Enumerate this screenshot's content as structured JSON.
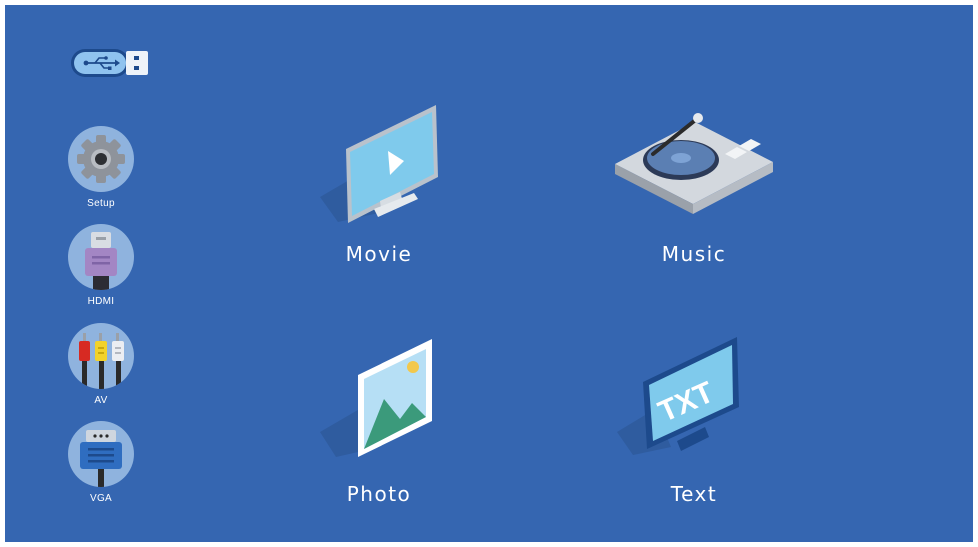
{
  "sources": [
    {
      "id": "setup",
      "label": "Setup",
      "icon": "gear-icon"
    },
    {
      "id": "hdmi",
      "label": "HDMI",
      "icon": "hdmi-plug-icon"
    },
    {
      "id": "av",
      "label": "AV",
      "icon": "rca-cables-icon"
    },
    {
      "id": "vga",
      "label": "VGA",
      "icon": "vga-plug-icon"
    }
  ],
  "media": {
    "movie": {
      "label": "Movie",
      "icon": "monitor-play-icon"
    },
    "music": {
      "label": "Music",
      "icon": "turntable-icon"
    },
    "photo": {
      "label": "Photo",
      "icon": "picture-frame-icon"
    },
    "text": {
      "label": "Text",
      "icon": "txt-screen-icon",
      "screen_text": "TXT"
    }
  },
  "status": {
    "usb_icon": "usb-drive-icon",
    "usb_connected": true
  },
  "colors": {
    "background": "#3566b1",
    "accent_light": "#8fb3de",
    "label": "#ffffff"
  }
}
